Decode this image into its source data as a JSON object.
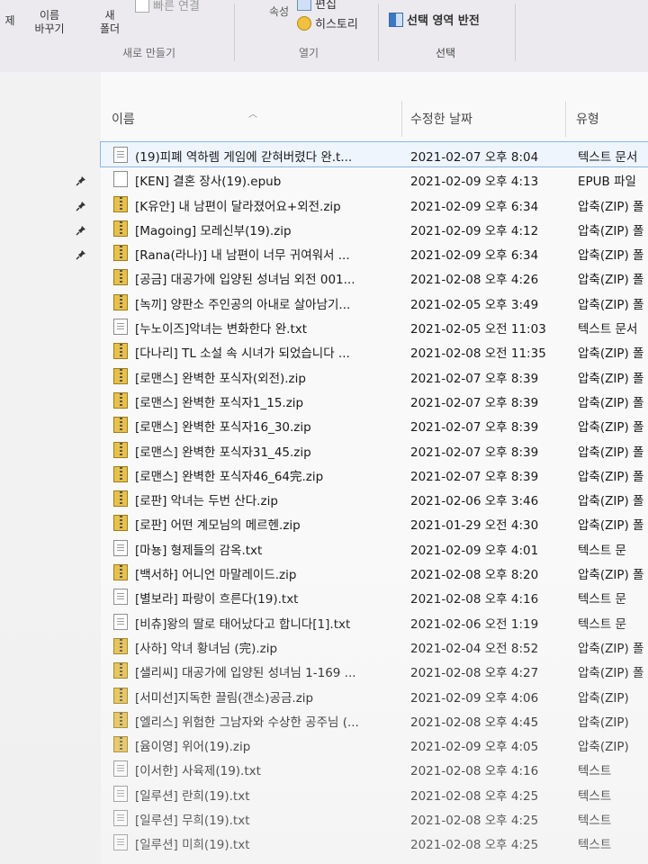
{
  "ribbon": {
    "left_buttons": [
      {
        "label_top": "",
        "label_bottom": "",
        "icon": "delete-icon",
        "text": "제"
      },
      {
        "label_top": "이름",
        "label_bottom": "바꾸기",
        "icon": "rename-icon"
      },
      {
        "label_top": "새",
        "label_bottom": "폴더",
        "icon": "new-folder-icon"
      }
    ],
    "new_item_label": "빠른 연결",
    "properties_label": "속성",
    "edit_label": "편집",
    "history_label": "히스토리",
    "invert_selection_label": "선택 영역 반전",
    "group_new": "새로 만들기",
    "group_open": "열기",
    "group_select": "선택"
  },
  "columns": {
    "name": "이름",
    "modified": "수정한 날짜",
    "type": "유형"
  },
  "files": [
    {
      "name": "(19)피폐 역하렘 게임에 갇혀버렸다 완.t...",
      "date": "2021-02-07 오후 8:04",
      "type": "텍스트 문서",
      "icon": "txt",
      "pinned": false,
      "selected": true
    },
    {
      "name": "[KEN] 결혼 장사(19).epub",
      "date": "2021-02-09 오후 4:13",
      "type": "EPUB 파일",
      "icon": "epub",
      "pinned": true
    },
    {
      "name": "[K유안] 내 남편이 달라졌어요+외전.zip",
      "date": "2021-02-09 오후 6:34",
      "type": "압축(ZIP) 폴",
      "icon": "zip",
      "pinned": true
    },
    {
      "name": "[Magoing] 모레신부(19).zip",
      "date": "2021-02-09 오후 4:12",
      "type": "압축(ZIP) 폴",
      "icon": "zip",
      "pinned": true
    },
    {
      "name": "[Rana(라나)] 내 남편이 너무 귀여워서 ...",
      "date": "2021-02-09 오후 6:34",
      "type": "압축(ZIP) 폴",
      "icon": "zip",
      "pinned": true
    },
    {
      "name": "[공금] 대공가에 입양된 성녀님 외전 001...",
      "date": "2021-02-08 오후 4:26",
      "type": "압축(ZIP) 폴",
      "icon": "zip"
    },
    {
      "name": "[녹끼] 양판소 주인공의 아내로 살아남기...",
      "date": "2021-02-05 오후 3:49",
      "type": "압축(ZIP) 폴",
      "icon": "zip"
    },
    {
      "name": "[누노이즈]악녀는 변화한다 완.txt",
      "date": "2021-02-05 오전 11:03",
      "type": "텍스트 문서",
      "icon": "txt"
    },
    {
      "name": "[다나리] TL 소설 속 시녀가 되었습니다 ...",
      "date": "2021-02-08 오전 11:35",
      "type": "압축(ZIP) 폴",
      "icon": "zip"
    },
    {
      "name": "[로맨스] 완벽한 포식자(외전).zip",
      "date": "2021-02-07 오후 8:39",
      "type": "압축(ZIP) 폴",
      "icon": "zip"
    },
    {
      "name": "[로맨스] 완벽한 포식자1_15.zip",
      "date": "2021-02-07 오후 8:39",
      "type": "압축(ZIP) 폴",
      "icon": "zip"
    },
    {
      "name": "[로맨스] 완벽한 포식자16_30.zip",
      "date": "2021-02-07 오후 8:39",
      "type": "압축(ZIP) 폴",
      "icon": "zip"
    },
    {
      "name": "[로맨스] 완벽한 포식자31_45.zip",
      "date": "2021-02-07 오후 8:39",
      "type": "압축(ZIP) 폴",
      "icon": "zip"
    },
    {
      "name": "[로맨스] 완벽한 포식자46_64完.zip",
      "date": "2021-02-07 오후 8:39",
      "type": "압축(ZIP) 폴",
      "icon": "zip"
    },
    {
      "name": "[로판] 악녀는 두번 산다.zip",
      "date": "2021-02-06 오후 3:46",
      "type": "압축(ZIP) 폴",
      "icon": "zip"
    },
    {
      "name": "[로판] 어떤 계모님의 메르헨.zip",
      "date": "2021-01-29 오전 4:30",
      "type": "압축(ZIP) 폴",
      "icon": "zip"
    },
    {
      "name": "[마뇽] 형제들의 감옥.txt",
      "date": "2021-02-09 오후 4:01",
      "type": "텍스트 문",
      "icon": "txt"
    },
    {
      "name": "[백서하] 어니언 마말레이드.zip",
      "date": "2021-02-08 오후 8:20",
      "type": "압축(ZIP) 폴",
      "icon": "zip"
    },
    {
      "name": "[별보라] 파랑이 흐른다(19).txt",
      "date": "2021-02-08 오후 4:16",
      "type": "텍스트 문",
      "icon": "txt"
    },
    {
      "name": "[비츄]왕의 딸로 태어났다고 합니다[1].txt",
      "date": "2021-02-06 오전 1:19",
      "type": "텍스트 문",
      "icon": "txt"
    },
    {
      "name": "[사하] 악녀 황녀님 (完).zip",
      "date": "2021-02-04 오전 8:52",
      "type": "압축(ZIP) 폴",
      "icon": "zip"
    },
    {
      "name": "[샐리씨] 대공가에 입양된 성녀님 1-169 ...",
      "date": "2021-02-08 오후 4:27",
      "type": "압축(ZIP) 폴",
      "icon": "zip"
    },
    {
      "name": "[서미선]지독한 끌림(갠소)공금.zip",
      "date": "2021-02-09 오후 4:06",
      "type": "압축(ZIP)",
      "icon": "zip"
    },
    {
      "name": "[엘리스] 위험한 그남자와 수상한 공주님 (...",
      "date": "2021-02-08 오후 4:45",
      "type": "압축(ZIP)",
      "icon": "zip"
    },
    {
      "name": "[윰이영] 위어(19).zip",
      "date": "2021-02-09 오후 4:05",
      "type": "압축(ZIP)",
      "icon": "zip"
    },
    {
      "name": "[이서한] 사육제(19).txt",
      "date": "2021-02-08 오후 4:16",
      "type": "텍스트",
      "icon": "txt"
    },
    {
      "name": "[일루션] 란희(19).txt",
      "date": "2021-02-08 오후 4:25",
      "type": "텍스트",
      "icon": "txt"
    },
    {
      "name": "[일루션] 무희(19).txt",
      "date": "2021-02-08 오후 4:25",
      "type": "텍스트",
      "icon": "txt"
    },
    {
      "name": "[일루션] 미희(19).txt",
      "date": "2021-02-08 오후 4:25",
      "type": "텍스트",
      "icon": "txt"
    }
  ],
  "colors": {
    "zip": "#e8c04a",
    "selection": "#8ab6e6",
    "ribbon_bg": "#eceaee"
  }
}
